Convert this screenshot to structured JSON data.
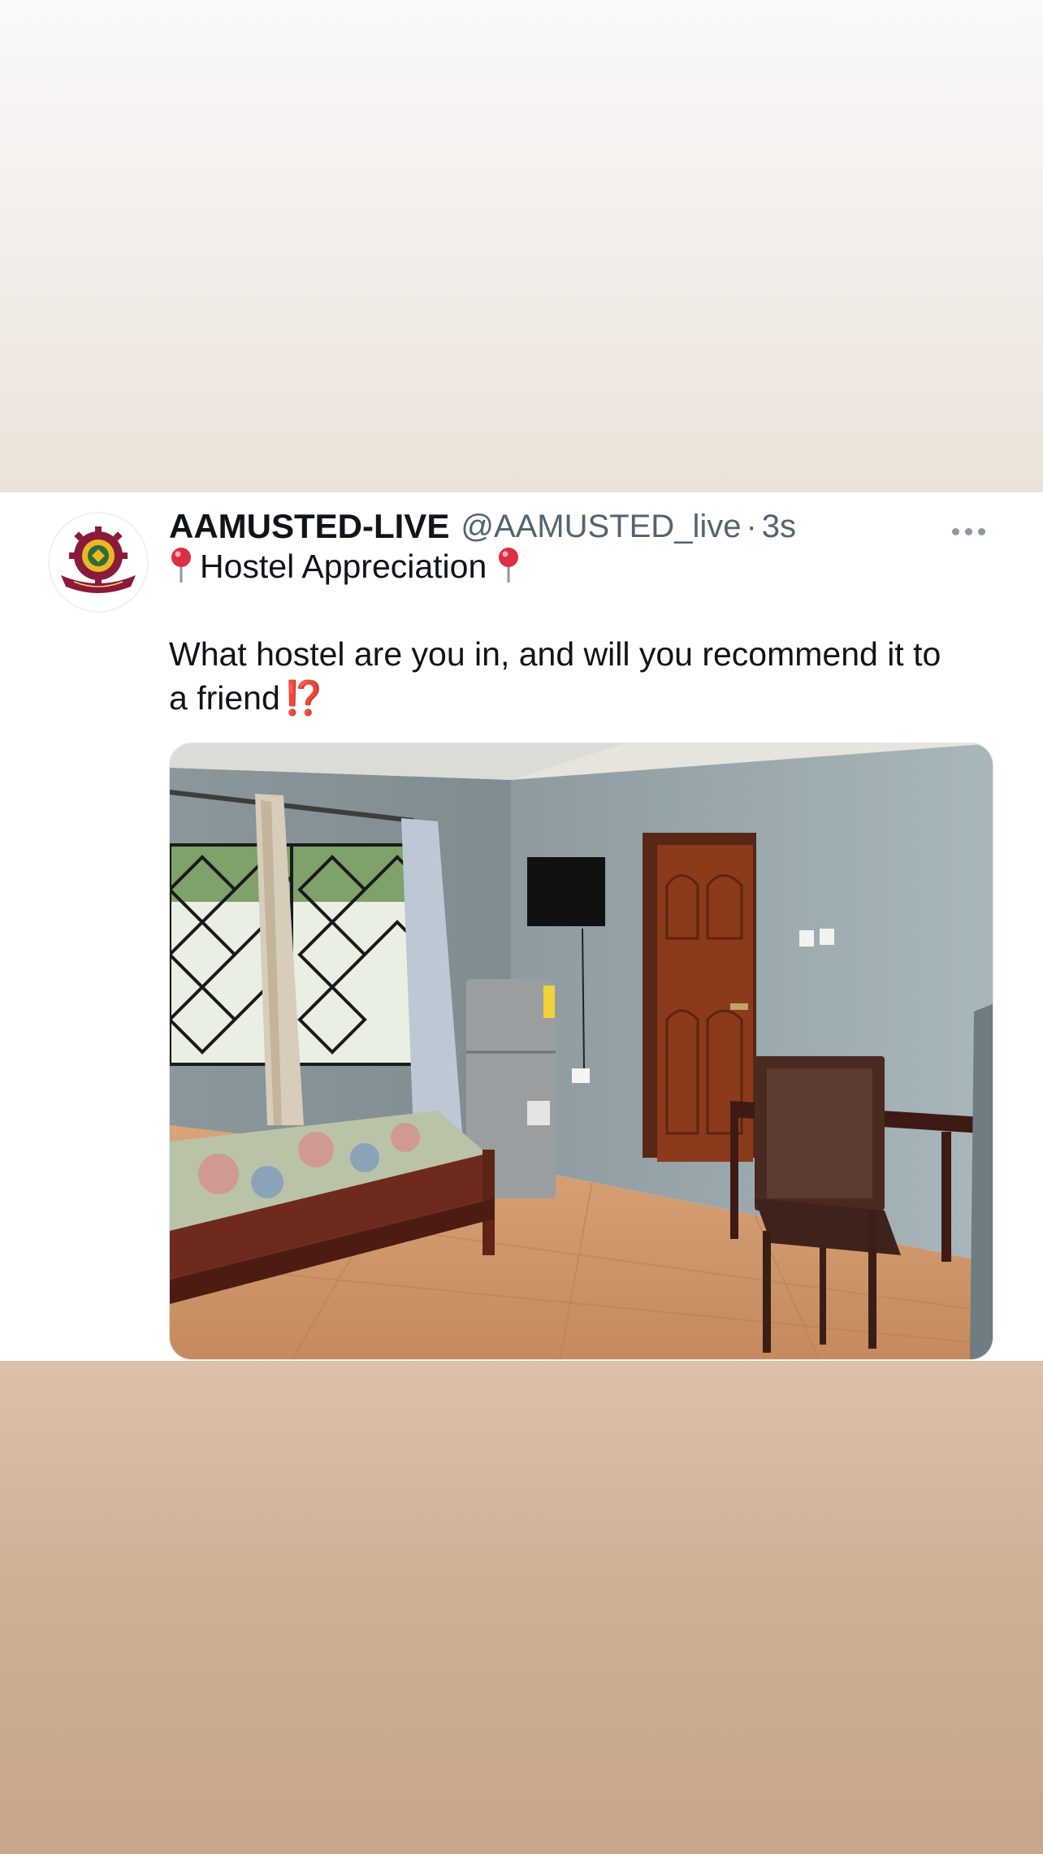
{
  "tweet": {
    "display_name": "AAMUSTED-LIVE",
    "handle": "@AAMUSTED_live",
    "separator": "·",
    "time": "3s",
    "text_line1": "Hostel Appreciation",
    "text_line2": "What hostel are you in, and will you recommend it to",
    "text_line3": "a friend",
    "emphasis_emoji": "⁉️",
    "more_icon": "more-horizontal-icon",
    "pin_icon": "round-pushpin-icon",
    "media_alt": "hostel room with bed, fridge, TV, wooden door, desk and chair"
  },
  "colors": {
    "name_text": "#0f1419",
    "secondary_text": "#536471",
    "card_background": "#ffffff",
    "logo_maroon": "#8b1a3a",
    "logo_gold": "#e8b923"
  }
}
